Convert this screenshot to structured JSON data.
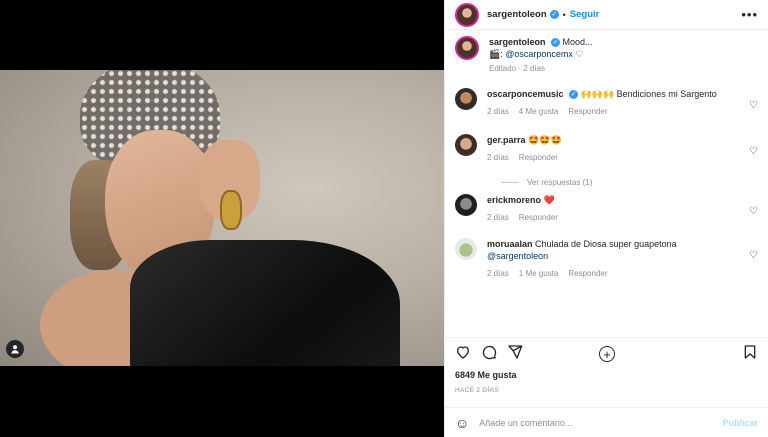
{
  "post": {
    "username": "sargentoleon",
    "follow_label": "Seguir",
    "caption_title": "Mood...",
    "caption_credit_prefix": "🎬: ",
    "caption_credit_mention": "@oscarponcemx",
    "caption_suffix": " ♡",
    "caption_meta": "Editado · 2 días",
    "likes": "6849 Me gusta",
    "posted_ago": "HACE 2 DÍAS"
  },
  "comments": [
    {
      "user": "oscarponcemusic",
      "verified": true,
      "text": " 🙌🙌🙌 Bendiciones mi Sargento",
      "age": "2 días",
      "likes": "4 Me gusta",
      "reply": "Responder"
    },
    {
      "user": "ger.parra",
      "verified": false,
      "text": " 🤩🤩🤩",
      "age": "2 días",
      "likes": "",
      "reply": "Responder",
      "view_replies": "Ver respuestas (1)"
    },
    {
      "user": "erickmoreno",
      "verified": false,
      "text": " ❤️",
      "age": "2 días",
      "likes": "",
      "reply": "Responder"
    },
    {
      "user": "moruaalan",
      "verified": false,
      "text": " Chulada de Diosa super guapetona",
      "mention": "@sargentoleon",
      "age": "2 días",
      "likes": "1 Me gusta",
      "reply": "Responder"
    }
  ],
  "composer": {
    "placeholder": "Añade un comentario...",
    "post_label": "Publicar"
  },
  "icons": {
    "more": "more-icon",
    "heart": "heart-icon",
    "comment": "comment-icon",
    "share": "share-icon",
    "save": "bookmark-icon",
    "emoji": "emoji-icon",
    "add": "add-circle-icon"
  }
}
